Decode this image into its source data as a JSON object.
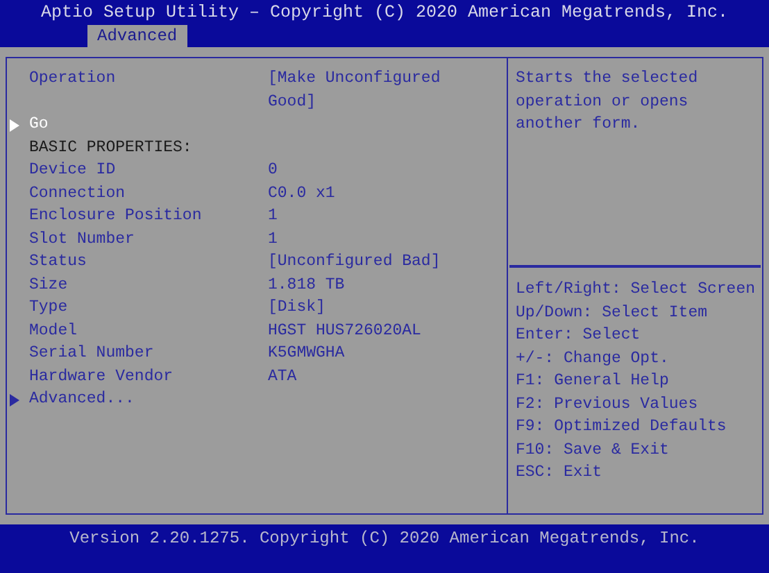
{
  "title": "Aptio Setup Utility – Copyright (C) 2020 American Megatrends, Inc.",
  "tabs": [
    {
      "label": "Advanced",
      "selected": true
    }
  ],
  "items": [
    {
      "kind": "setting",
      "label": "Operation",
      "value": "[Make Unconfigured Good]"
    },
    {
      "kind": "submenu",
      "label": "Go",
      "selected": true
    },
    {
      "kind": "header",
      "label": "BASIC PROPERTIES:"
    },
    {
      "kind": "setting",
      "label": "Device ID",
      "value": "0"
    },
    {
      "kind": "setting",
      "label": "Connection",
      "value": "C0.0 x1"
    },
    {
      "kind": "setting",
      "label": "Enclosure Position",
      "value": "1"
    },
    {
      "kind": "setting",
      "label": "Slot Number",
      "value": "1"
    },
    {
      "kind": "setting",
      "label": "Status",
      "value": "[Unconfigured Bad]"
    },
    {
      "kind": "setting",
      "label": "Size",
      "value": "1.818 TB"
    },
    {
      "kind": "setting",
      "label": "Type",
      "value": "[Disk]"
    },
    {
      "kind": "setting",
      "label": "Model",
      "value": "HGST HUS726020AL"
    },
    {
      "kind": "setting",
      "label": "Serial Number",
      "value": "K5GMWGHA"
    },
    {
      "kind": "setting",
      "label": "Hardware Vendor",
      "value": "ATA"
    },
    {
      "kind": "submenu",
      "label": "Advanced...",
      "selected": false
    }
  ],
  "help_text": "Starts the selected operation or opens another form.",
  "key_help": [
    "Left/Right: Select Screen",
    "Up/Down: Select Item",
    "Enter: Select",
    "+/-: Change Opt.",
    "F1: General Help",
    "F2: Previous Values",
    "F9: Optimized Defaults",
    "F10: Save & Exit",
    "ESC: Exit"
  ],
  "footer": "Version 2.20.1275. Copyright (C) 2020 American Megatrends, Inc."
}
